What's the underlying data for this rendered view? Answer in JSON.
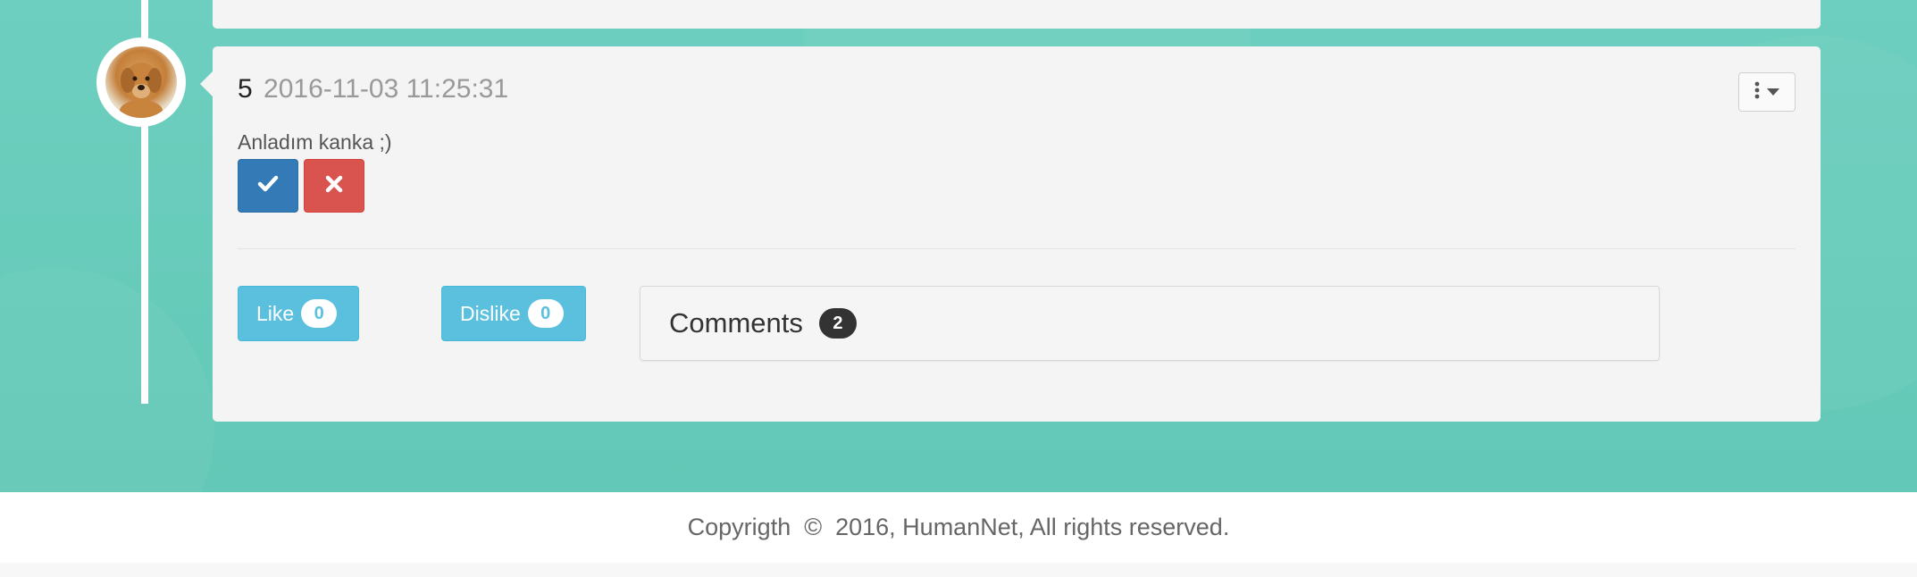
{
  "post": {
    "number": "5",
    "timestamp": "2016-11-03 11:25:31",
    "body": "Anladım kanka ;)",
    "menu_icon": "dots-vertical-icon",
    "approve_icon": "check-icon",
    "reject_icon": "close-icon"
  },
  "reactions": {
    "like_label": "Like",
    "like_count": "0",
    "dislike_label": "Dislike",
    "dislike_count": "0"
  },
  "comments": {
    "title": "Comments",
    "count": "2"
  },
  "footer": {
    "text": "Copyrigth  ©  2016, HumanNet, All rights reserved."
  },
  "colors": {
    "background": "#66ccbb",
    "card": "#f4f4f4",
    "approve": "#337ab7",
    "reject": "#d9534f",
    "info": "#5bc0de",
    "badge_dark": "#333333"
  }
}
